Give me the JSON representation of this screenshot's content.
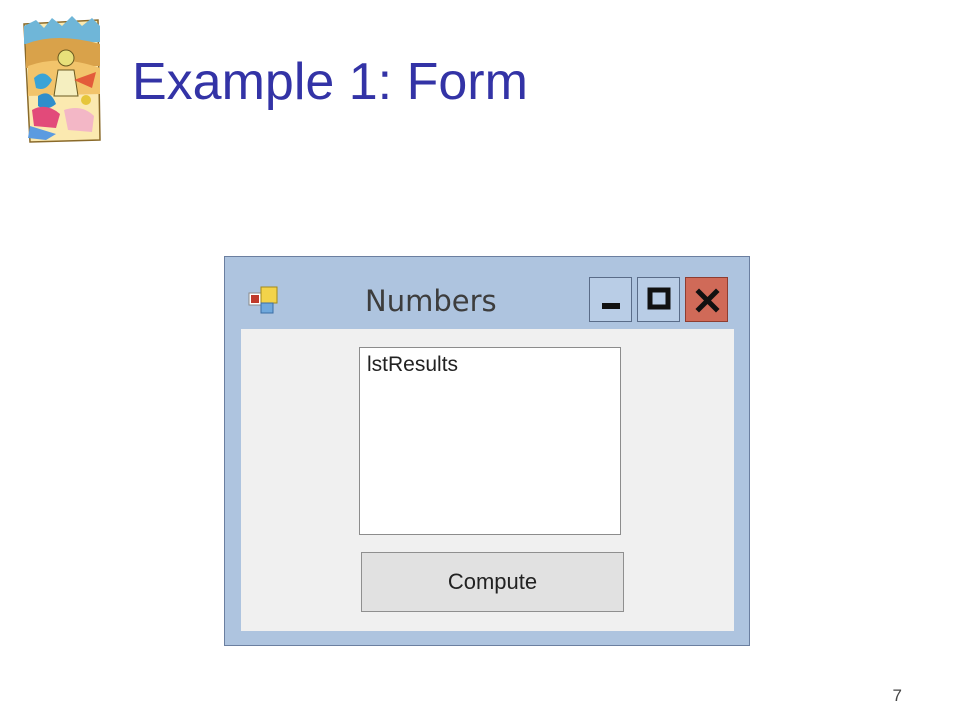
{
  "slide": {
    "title": "Example 1: Form",
    "page_number": "7"
  },
  "window": {
    "title": "Numbers",
    "icon": "form-app-icon",
    "controls": {
      "minimize_icon": "minimize-icon",
      "maximize_icon": "maximize-icon",
      "close_icon": "close-icon"
    },
    "listbox": {
      "name": "lstResults",
      "text": "lstResults"
    },
    "button": {
      "label": "Compute"
    }
  },
  "colors": {
    "title": "#3333a6",
    "window_frame": "#aec4df",
    "close_button": "#d06a58",
    "client_area": "#f0f0f0"
  },
  "decorations": {
    "clipart": "slide-clipart-illustration"
  }
}
